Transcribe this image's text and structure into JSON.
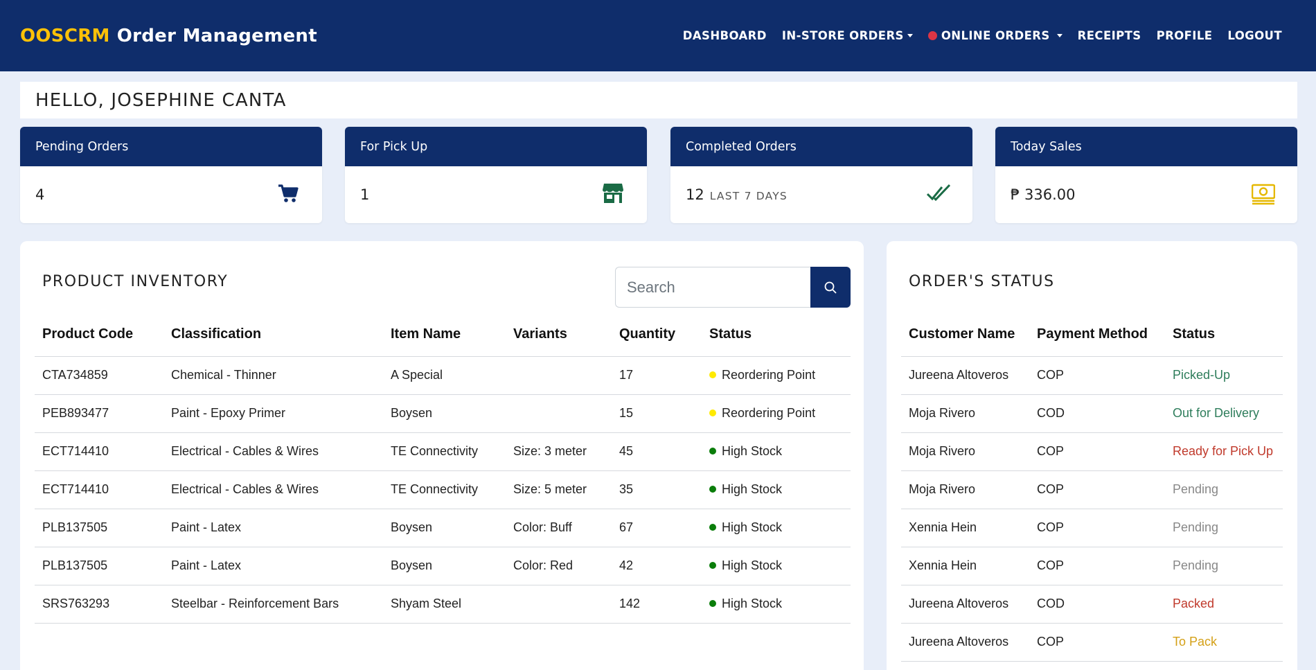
{
  "app": {
    "brand_highlight": "OOSCRM",
    "brand_rest": "Order Management"
  },
  "nav": {
    "items": [
      {
        "label": "DASHBOARD"
      },
      {
        "label": "IN-STORE ORDERS"
      },
      {
        "label": "ONLINE ORDERS"
      },
      {
        "label": "RECEIPTS"
      },
      {
        "label": "PROFILE"
      },
      {
        "label": "LOGOUT"
      }
    ],
    "online_orders_indicator_color": "#dc3545"
  },
  "greeting": "HELLO, JOSEPHINE CANTA",
  "cards": {
    "pending": {
      "title": "Pending Orders",
      "value": "4",
      "icon": "cart-icon",
      "icon_color": "#0f2d6b"
    },
    "pickup": {
      "title": "For Pick Up",
      "value": "1",
      "icon": "store-icon",
      "icon_color": "#1a6b45"
    },
    "completed": {
      "title": "Completed Orders",
      "value": "12",
      "sub": "LAST 7 DAYS",
      "icon": "double-check-icon",
      "icon_color": "#1a6b45"
    },
    "sales": {
      "title": "Today Sales",
      "value": "₱ 336.00",
      "icon": "money-icon",
      "icon_color": "#e5b800"
    }
  },
  "inventory": {
    "title": "PRODUCT INVENTORY",
    "search_placeholder": "Search",
    "columns": [
      "Product Code",
      "Classification",
      "Item Name",
      "Variants",
      "Quantity",
      "Status"
    ],
    "rows": [
      {
        "code": "CTA734859",
        "classification": "Chemical - Thinner",
        "item": "A Special",
        "variant": "",
        "qty": "17",
        "status": "Reordering Point",
        "status_color": "#ffea00"
      },
      {
        "code": "PEB893477",
        "classification": "Paint - Epoxy Primer",
        "item": "Boysen",
        "variant": "",
        "qty": "15",
        "status": "Reordering Point",
        "status_color": "#ffea00"
      },
      {
        "code": "ECT714410",
        "classification": "Electrical - Cables & Wires",
        "item": "TE Connectivity",
        "variant": "Size: 3 meter",
        "qty": "45",
        "status": "High Stock",
        "status_color": "#0a7d0a"
      },
      {
        "code": "ECT714410",
        "classification": "Electrical - Cables & Wires",
        "item": "TE Connectivity",
        "variant": "Size: 5 meter",
        "qty": "35",
        "status": "High Stock",
        "status_color": "#0a7d0a"
      },
      {
        "code": "PLB137505",
        "classification": "Paint - Latex",
        "item": "Boysen",
        "variant": "Color: Buff",
        "qty": "67",
        "status": "High Stock",
        "status_color": "#0a7d0a"
      },
      {
        "code": "PLB137505",
        "classification": "Paint - Latex",
        "item": "Boysen",
        "variant": "Color: Red",
        "qty": "42",
        "status": "High Stock",
        "status_color": "#0a7d0a"
      },
      {
        "code": "SRS763293",
        "classification": "Steelbar - Reinforcement Bars",
        "item": "Shyam Steel",
        "variant": "",
        "qty": "142",
        "status": "High Stock",
        "status_color": "#0a7d0a"
      }
    ]
  },
  "orders": {
    "title": "ORDER'S STATUS",
    "columns": [
      "Customer Name",
      "Payment Method",
      "Status"
    ],
    "rows": [
      {
        "customer": "Jureena Altoveros",
        "payment": "COP",
        "status": "Picked-Up",
        "status_color": "#2e7d5b"
      },
      {
        "customer": "Moja Rivero",
        "payment": "COD",
        "status": "Out for Delivery",
        "status_color": "#2e7d5b"
      },
      {
        "customer": "Moja Rivero",
        "payment": "COP",
        "status": "Ready for Pick Up",
        "status_color": "#c0392b"
      },
      {
        "customer": "Moja Rivero",
        "payment": "COP",
        "status": "Pending",
        "status_color": "#888888"
      },
      {
        "customer": "Xennia Hein",
        "payment": "COP",
        "status": "Pending",
        "status_color": "#888888"
      },
      {
        "customer": "Xennia Hein",
        "payment": "COP",
        "status": "Pending",
        "status_color": "#888888"
      },
      {
        "customer": "Jureena Altoveros",
        "payment": "COD",
        "status": "Packed",
        "status_color": "#c0392b"
      },
      {
        "customer": "Jureena Altoveros",
        "payment": "COP",
        "status": "To Pack",
        "status_color": "#d4a017"
      }
    ]
  }
}
